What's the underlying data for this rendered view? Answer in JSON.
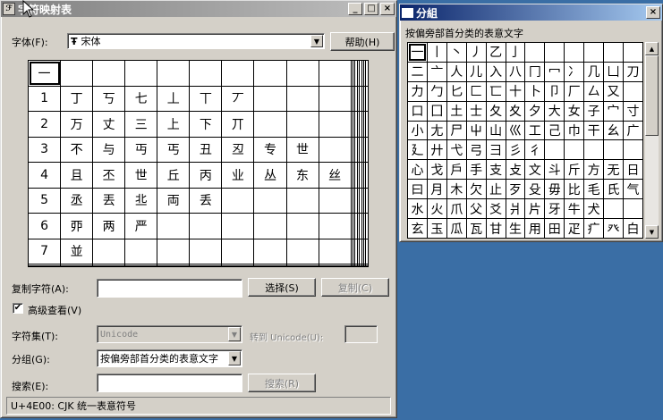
{
  "main": {
    "title": "字符映射表",
    "min": "_",
    "max": "□",
    "close": "×",
    "font_label": "字体(F):",
    "font_value": "宋体",
    "font_icon": "Ŧ",
    "help": "帮助(H)",
    "copy_label": "复制字符(A):",
    "select_btn": "选择(S)",
    "copy_btn": "复制(C)",
    "advanced_label": "高级查看(V)",
    "advanced_checked": "✔",
    "charset_label": "字符集(T):",
    "charset_value": "Unicode",
    "goto_label": "转到 Unicode(U):",
    "group_label": "分组(G):",
    "group_value": "按偏旁部首分类的表意文字",
    "search_label": "搜索(E):",
    "search_btn": "搜索(R)",
    "status": "U+4E00: CJK 统一表意符号",
    "grid": [
      [
        "一",
        "",
        "",
        "",
        "",
        "",
        "",
        "",
        "",
        "",
        "",
        "",
        "",
        "",
        "",
        "",
        "",
        ""
      ],
      [
        "1",
        "丁",
        "丂",
        "七",
        "丄",
        "丅",
        "丆",
        "",
        "",
        "",
        "",
        "",
        "",
        "",
        "",
        "",
        "",
        ""
      ],
      [
        "2",
        "万",
        "丈",
        "三",
        "上",
        "下",
        "丌",
        "",
        "",
        "",
        "",
        "",
        "",
        "",
        "",
        "",
        "",
        ""
      ],
      [
        "3",
        "不",
        "与",
        "丏",
        "丐",
        "丑",
        "丒",
        "专",
        "世",
        "",
        "",
        "",
        "",
        "",
        "",
        "",
        "",
        ""
      ],
      [
        "4",
        "且",
        "丕",
        "世",
        "丘",
        "丙",
        "业",
        "丛",
        "东",
        "丝",
        "",
        "",
        "",
        "",
        "",
        "",
        "",
        ""
      ],
      [
        "5",
        "丞",
        "丟",
        "丠",
        "両",
        "丢",
        "",
        "",
        "",
        "",
        "",
        "",
        "",
        "",
        "",
        "",
        "",
        ""
      ],
      [
        "6",
        "丣",
        "两",
        "严",
        "",
        "",
        "",
        "",
        "",
        "",
        "",
        "",
        "",
        "",
        "",
        "",
        "",
        ""
      ],
      [
        "7",
        "並",
        "",
        "",
        "",
        "",
        "",
        "",
        "",
        "",
        "",
        "",
        "",
        "",
        "",
        "",
        "",
        ""
      ],
      [
        "",
        "",
        "",
        "",
        "",
        "",
        "",
        "",
        "",
        "",
        "",
        "",
        "",
        "",
        "",
        "",
        "",
        ""
      ],
      [
        "",
        "",
        "",
        "",
        "",
        "",
        "",
        "",
        "",
        "",
        "",
        "",
        "",
        "",
        "",
        "",
        "",
        ""
      ]
    ]
  },
  "group": {
    "title": "分組",
    "close": "×",
    "caption": "按偏旁部首分类的表意文字",
    "grid": [
      [
        "一",
        "丨",
        "丶",
        "丿",
        "乙",
        "亅",
        "",
        "",
        "",
        "",
        "",
        ""
      ],
      [
        "二",
        "亠",
        "人",
        "儿",
        "入",
        "八",
        "冂",
        "冖",
        "冫",
        "几",
        "凵",
        "刀"
      ],
      [
        "力",
        "勹",
        "匕",
        "匚",
        "匸",
        "十",
        "卜",
        "卩",
        "厂",
        "厶",
        "又",
        ""
      ],
      [
        "口",
        "囗",
        "土",
        "士",
        "夂",
        "夊",
        "夕",
        "大",
        "女",
        "子",
        "宀",
        "寸"
      ],
      [
        "小",
        "尢",
        "尸",
        "屮",
        "山",
        "巛",
        "工",
        "己",
        "巾",
        "干",
        "幺",
        "广"
      ],
      [
        "廴",
        "廾",
        "弋",
        "弓",
        "彐",
        "彡",
        "彳",
        "",
        "",
        "",
        "",
        ""
      ],
      [
        "心",
        "戈",
        "戶",
        "手",
        "支",
        "攴",
        "文",
        "斗",
        "斤",
        "方",
        "无",
        "日"
      ],
      [
        "曰",
        "月",
        "木",
        "欠",
        "止",
        "歹",
        "殳",
        "毋",
        "比",
        "毛",
        "氏",
        "气"
      ],
      [
        "水",
        "火",
        "爪",
        "父",
        "爻",
        "爿",
        "片",
        "牙",
        "牛",
        "犬",
        "",
        ""
      ],
      [
        "玄",
        "玉",
        "瓜",
        "瓦",
        "甘",
        "生",
        "用",
        "田",
        "疋",
        "疒",
        "癶",
        "白"
      ]
    ]
  }
}
